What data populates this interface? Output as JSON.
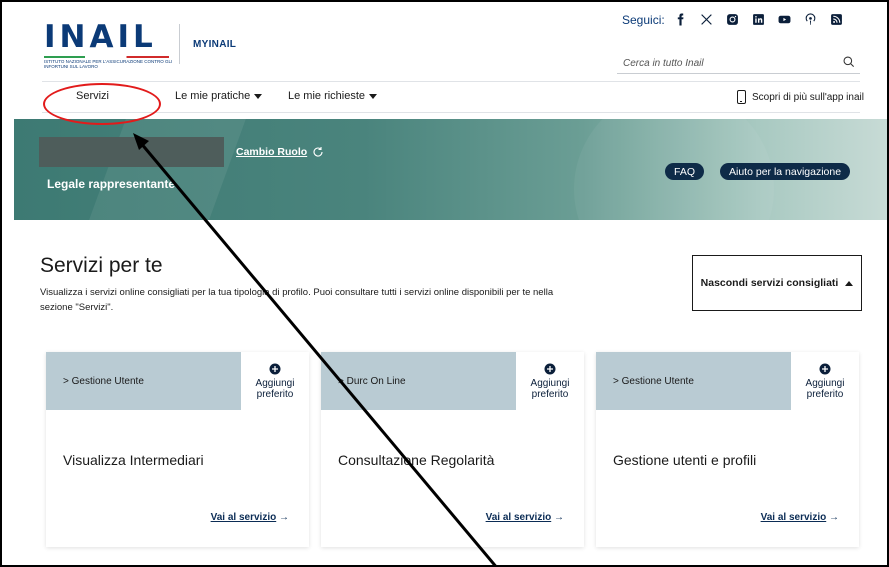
{
  "header": {
    "logo_text": "INAIL",
    "logo_subtitle": "ISTITUTO NAZIONALE PER L'ASSICURAZIONE CONTRO GLI INFORTUNI SUL LAVORO",
    "portal": "MYINAIL",
    "follow_label": "Seguici:",
    "social_icons": [
      "facebook-icon",
      "x-icon",
      "instagram-icon",
      "linkedin-icon",
      "youtube-icon",
      "podcast-icon",
      "rss-icon"
    ],
    "search_placeholder": "Cerca in tutto Inail"
  },
  "nav": {
    "items": [
      {
        "label": "Servizi"
      },
      {
        "label": "Le mie pratiche"
      },
      {
        "label": "Le mie richieste"
      }
    ],
    "app_link": "Scopri di più sull'app inail"
  },
  "banner": {
    "role": "Legale rappresentante",
    "change_role": "Cambio Ruolo",
    "faq": "FAQ",
    "help": "Aiuto per la navigazione"
  },
  "section": {
    "title": "Servizi per te",
    "description": "Visualizza i servizi online consigliati per la tua tipologia di profilo. Puoi consultare tutti i servizi online disponibili per te nella sezione \"Servizi\".",
    "hide_button": "Nascondi servizi consigliati"
  },
  "cards": [
    {
      "category": "> Gestione Utente",
      "favorite": "Aggiungi preferito",
      "title": "Visualizza Intermediari",
      "link": "Vai al servizio",
      "link_arrow": "→"
    },
    {
      "category": "> Durc On Line",
      "favorite": "Aggiungi preferito",
      "title": "Consultazione Regolarità",
      "link": "Vai al servizio",
      "link_arrow": "→"
    },
    {
      "category": "> Gestione Utente",
      "favorite": "Aggiungi preferito",
      "title": "Gestione utenti e profili",
      "link": "Vai al servizio",
      "link_arrow": "→"
    }
  ],
  "annotation": {
    "oval_color": "#e21b1b",
    "arrow_color": "#000000"
  },
  "colors": {
    "brand_blue": "#0b3a77",
    "pill_bg": "#0e2b48",
    "card_header": "#b9cbd3"
  }
}
